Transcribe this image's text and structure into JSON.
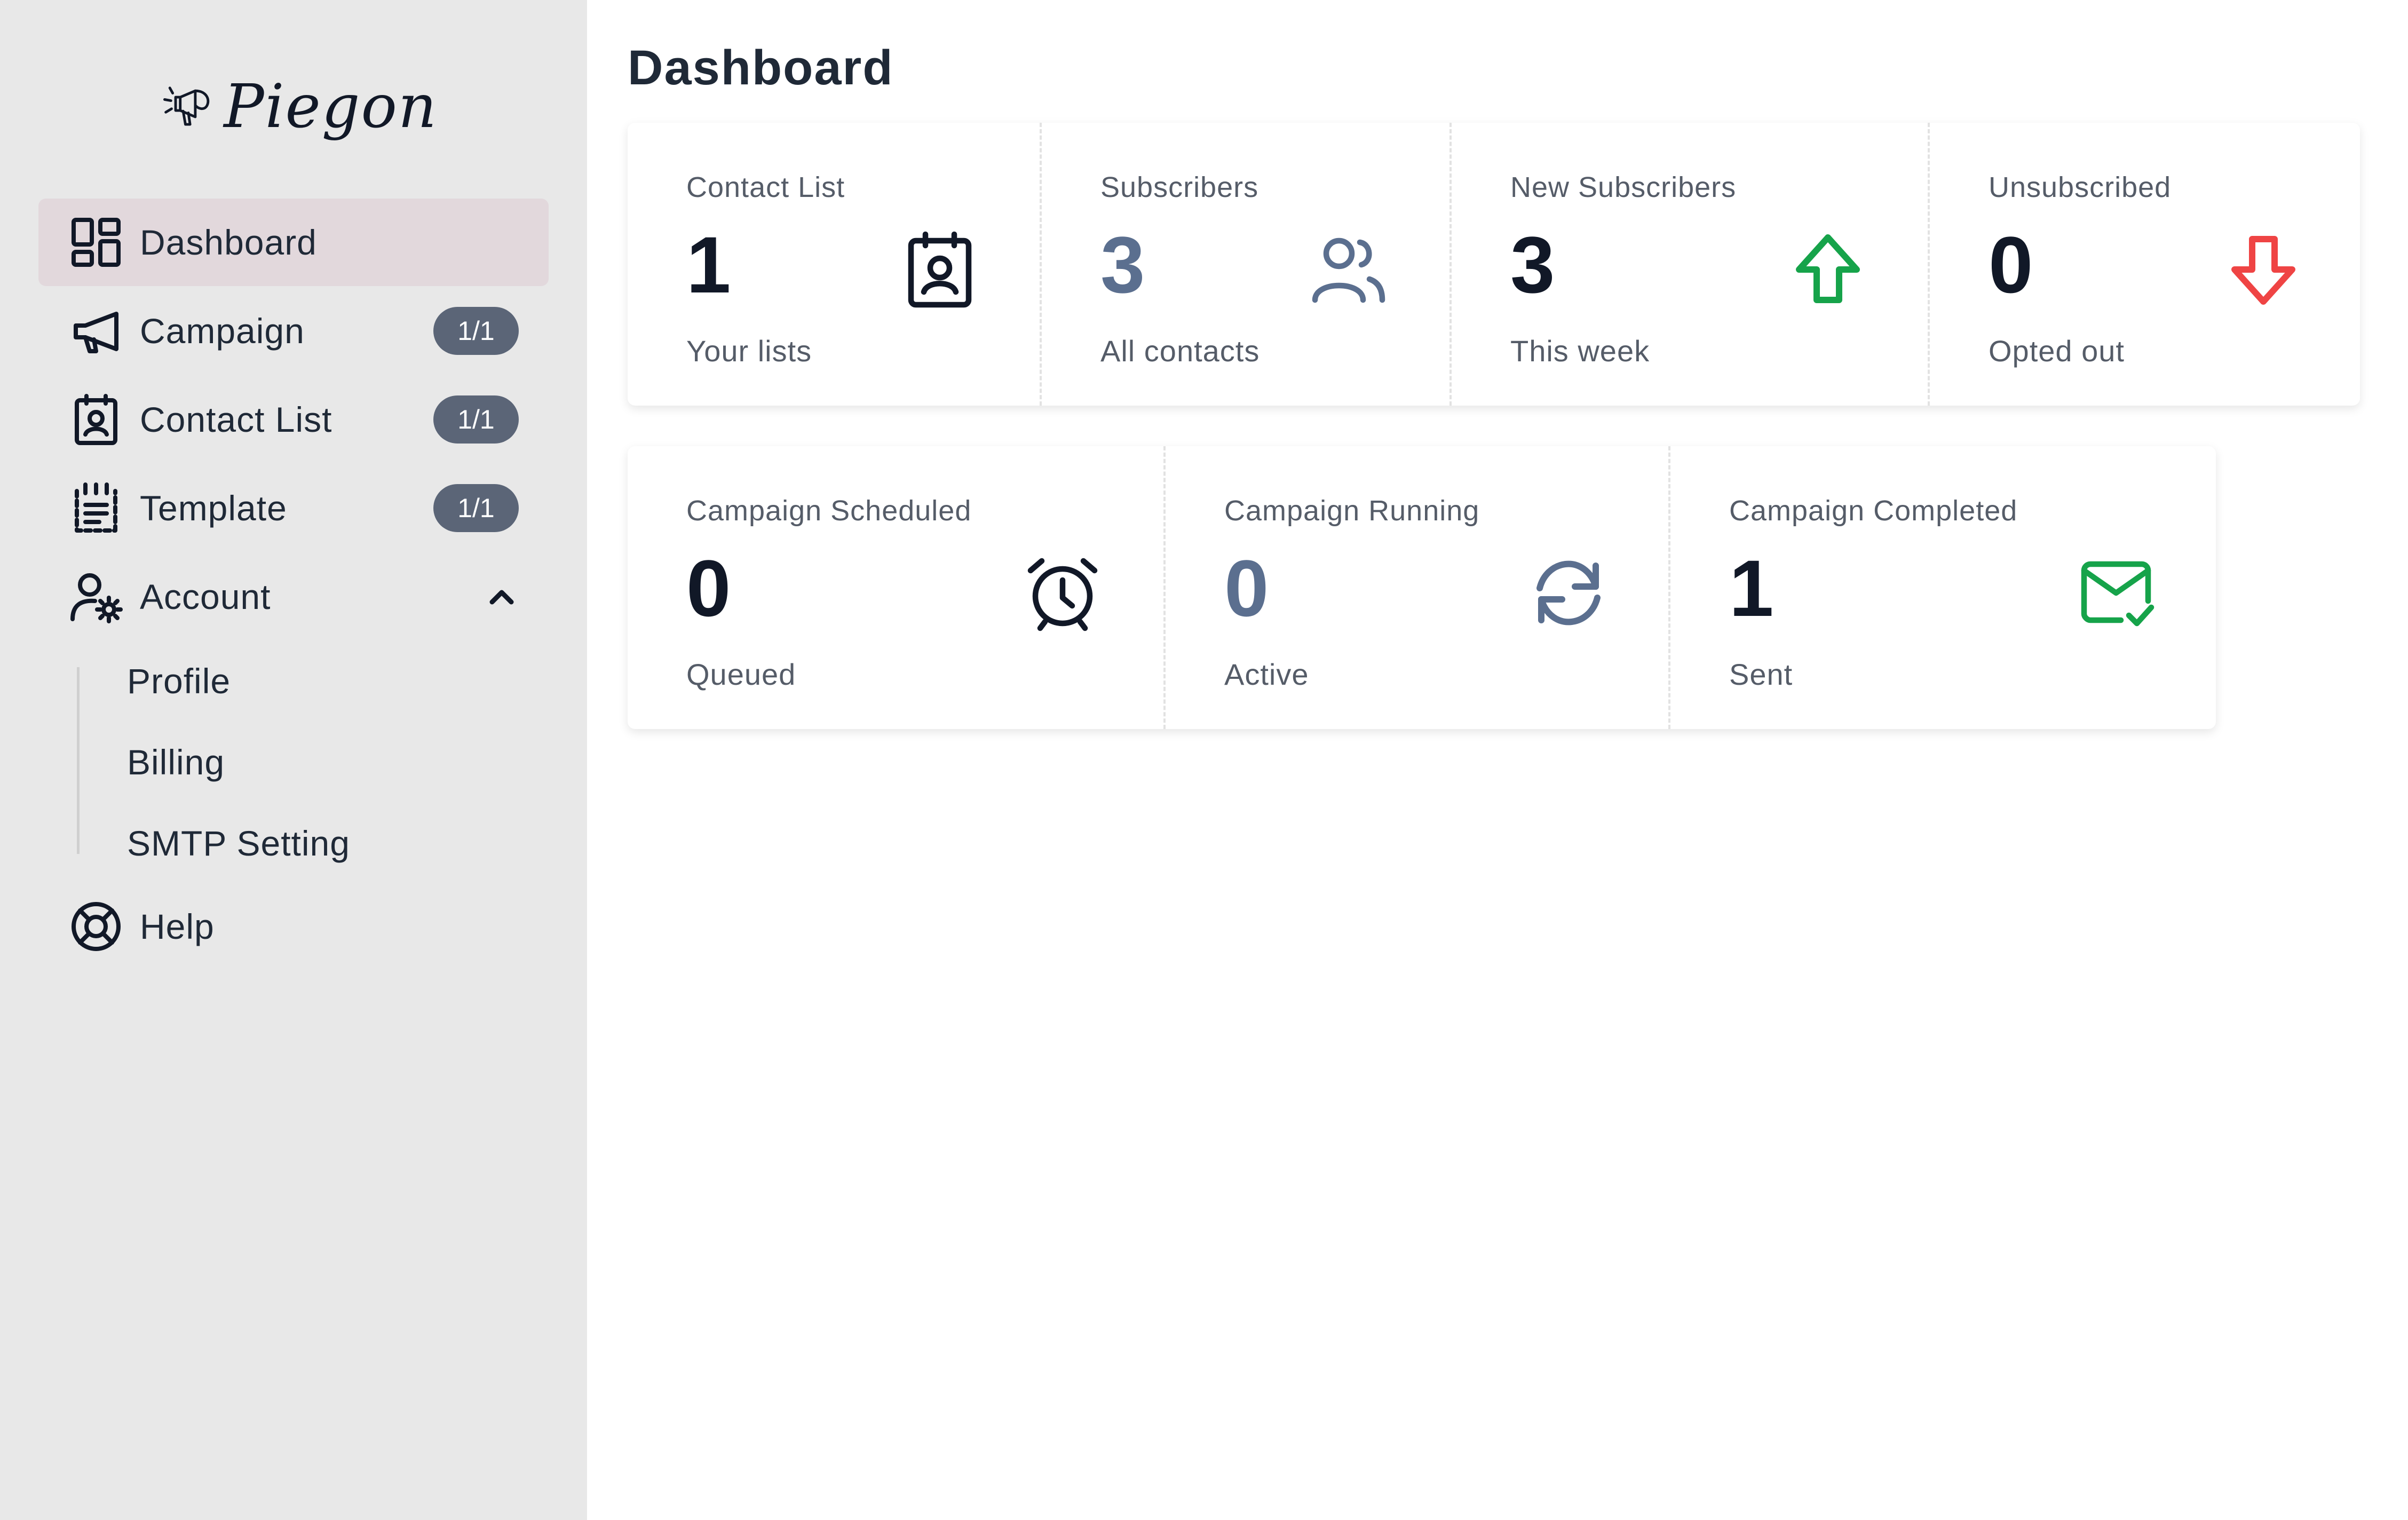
{
  "brand": {
    "name": "Piegon"
  },
  "sidebar": {
    "items": [
      {
        "label": "Dashboard",
        "icon": "dashboard-grid-icon",
        "active": true
      },
      {
        "label": "Campaign",
        "icon": "megaphone-icon",
        "badge": "1/1"
      },
      {
        "label": "Contact List",
        "icon": "contact-card-icon",
        "badge": "1/1"
      },
      {
        "label": "Template",
        "icon": "template-list-icon",
        "badge": "1/1"
      },
      {
        "label": "Account",
        "icon": "user-gear-icon",
        "expanded": true
      },
      {
        "label": "Help",
        "icon": "lifebuoy-icon"
      }
    ],
    "account_sub": [
      "Profile",
      "Billing",
      "SMTP Setting"
    ]
  },
  "main": {
    "title": "Dashboard",
    "stats_row1": [
      {
        "label": "Contact List",
        "value": "1",
        "desc": "Your lists",
        "icon": "contact-card-icon",
        "color": "#111827"
      },
      {
        "label": "Subscribers",
        "value": "3",
        "desc": "All contacts",
        "icon": "users-icon",
        "color": "#5b6f8f"
      },
      {
        "label": "New Subscribers",
        "value": "3",
        "desc": "This week",
        "icon": "arrow-up-icon",
        "color": "#16a34a"
      },
      {
        "label": "Unsubscribed",
        "value": "0",
        "desc": "Opted out",
        "icon": "arrow-down-icon",
        "color": "#ef4444"
      }
    ],
    "stats_row2": [
      {
        "label": "Campaign Scheduled",
        "value": "0",
        "desc": "Queued",
        "icon": "alarm-clock-icon",
        "color": "#111827"
      },
      {
        "label": "Campaign Running",
        "value": "0",
        "desc": "Active",
        "icon": "refresh-icon",
        "color": "#5b6f8f"
      },
      {
        "label": "Campaign Completed",
        "value": "1",
        "desc": "Sent",
        "icon": "mail-check-icon",
        "color": "#16a34a"
      }
    ]
  }
}
